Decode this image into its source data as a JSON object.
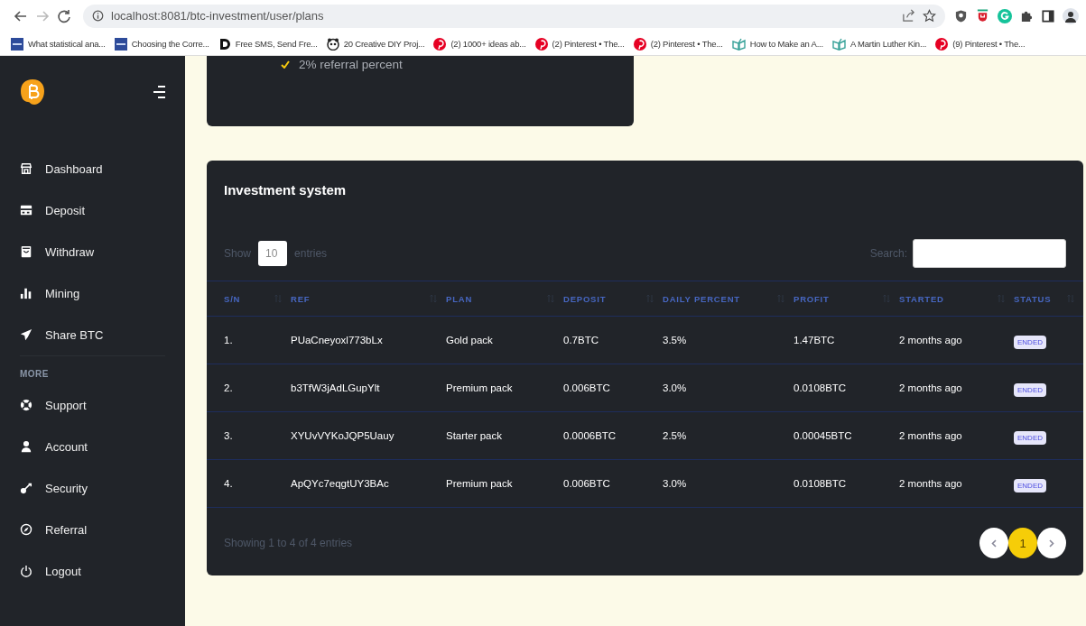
{
  "browser": {
    "url": "localhost:8081/btc-investment/user/plans",
    "bookmarks": [
      {
        "kind": "ucla",
        "label": "What statistical ana..."
      },
      {
        "kind": "ucla",
        "label": "Choosing the Corre..."
      },
      {
        "kind": "letter",
        "label": "Free SMS, Send Fre..."
      },
      {
        "kind": "panda",
        "label": "20 Creative DIY Proj..."
      },
      {
        "kind": "pinterest",
        "label": "(2) 1000+ ideas ab..."
      },
      {
        "kind": "pinterest",
        "label": "(2) Pinterest • The..."
      },
      {
        "kind": "pinterest",
        "label": "(2) Pinterest • The..."
      },
      {
        "kind": "book",
        "label": "How to Make an A..."
      },
      {
        "kind": "book",
        "label": "A Martin Luther Kin..."
      },
      {
        "kind": "pinterest",
        "label": "(9) Pinterest • The..."
      }
    ]
  },
  "sidebar": {
    "main_items": [
      {
        "label": "Dashboard"
      },
      {
        "label": "Deposit"
      },
      {
        "label": "Withdraw"
      },
      {
        "label": "Mining"
      },
      {
        "label": "Share BTC"
      }
    ],
    "section_title": "MORE",
    "more_items": [
      {
        "label": "Support"
      },
      {
        "label": "Account"
      },
      {
        "label": "Security"
      },
      {
        "label": "Referral"
      },
      {
        "label": "Logout"
      }
    ]
  },
  "plan_card": {
    "features": [
      "2% referral percent"
    ]
  },
  "investment_table": {
    "title": "Investment system",
    "show_label": "Show",
    "entries_value": "10",
    "entries_label": "entries",
    "search_label": "Search:",
    "columns": [
      "S/N",
      "REF",
      "PLAN",
      "DEPOSIT",
      "DAILY PERCENT",
      "PROFIT",
      "STARTED",
      "STATUS"
    ],
    "rows": [
      [
        "1.",
        "PUaCneyoxl773bLx",
        "Gold pack",
        "0.7BTC",
        "3.5%",
        "1.47BTC",
        "2 months ago",
        "ENDED"
      ],
      [
        "2.",
        "b3TfW3jAdLGupYlt",
        "Premium pack",
        "0.006BTC",
        "3.0%",
        "0.0108BTC",
        "2 months ago",
        "ENDED"
      ],
      [
        "3.",
        "XYUvVYKoJQP5Uauy",
        "Starter pack",
        "0.0006BTC",
        "2.5%",
        "0.00045BTC",
        "2 months ago",
        "ENDED"
      ],
      [
        "4.",
        "ApQYc7eqgtUY3BAc",
        "Premium pack",
        "0.006BTC",
        "3.0%",
        "0.0108BTC",
        "2 months ago",
        "ENDED"
      ]
    ],
    "info": "Showing 1 to 4 of 4 entries",
    "pages": [
      {
        "label": "1",
        "selected": true
      }
    ]
  }
}
